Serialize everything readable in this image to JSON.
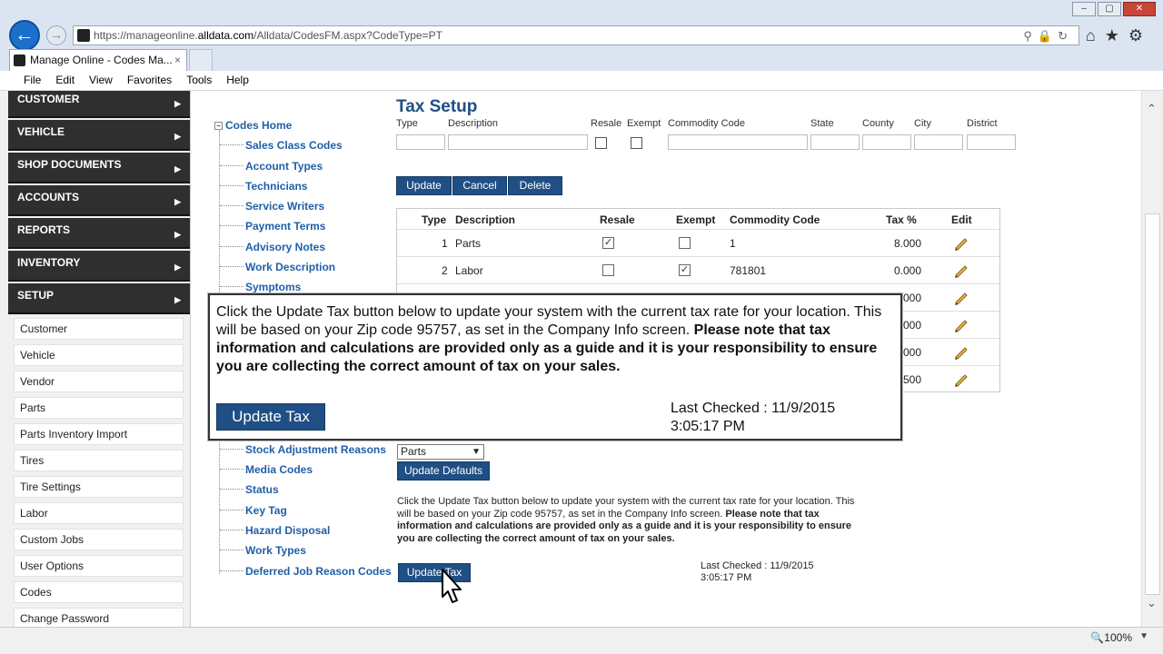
{
  "browser": {
    "url_prefix": "https://manageonline.",
    "url_domain": "alldata.com",
    "url_path": "/Alldata/CodesFM.aspx?CodeType=PT",
    "tab_title": "Manage Online - Codes Ma...",
    "tab_close": "×",
    "menu": [
      "File",
      "Edit",
      "View",
      "Favorites",
      "Tools",
      "Help"
    ],
    "zoom": "100%",
    "address_icons": "⚲🔒↻",
    "toolbar_icons": "⌂★⚙",
    "window_controls": [
      "–",
      "▢",
      "✕"
    ]
  },
  "sidebar": {
    "nav": [
      "CUSTOMER",
      "VEHICLE",
      "SHOP DOCUMENTS",
      "ACCOUNTS",
      "REPORTS",
      "INVENTORY",
      "SETUP"
    ],
    "arrow": "▶",
    "setup_items": [
      "Customer",
      "Vehicle",
      "Vendor",
      "Parts",
      "Parts Inventory Import",
      "Tires",
      "Tire Settings",
      "Labor",
      "Custom Jobs",
      "User Options",
      "Codes",
      "Change Password"
    ]
  },
  "tree": {
    "home": "Codes Home",
    "home_toggle": "−",
    "items_top": [
      "Sales Class Codes",
      "Account Types",
      "Technicians",
      "Service Writers",
      "Payment Terms",
      "Advisory Notes",
      "Work Description",
      "Symptoms"
    ],
    "items_bottom": [
      "Stock Adjustment Reasons",
      "Media Codes",
      "Status",
      "Key Tag",
      "Hazard Disposal",
      "Work Types",
      "Deferred Job Reason Codes"
    ]
  },
  "form": {
    "title": "Tax Setup",
    "labels": {
      "type": "Type",
      "description": "Description",
      "resale": "Resale",
      "exempt": "Exempt",
      "commodity": "Commodity Code",
      "state": "State",
      "county": "County",
      "city": "City",
      "district": "District"
    },
    "buttons": {
      "update": "Update",
      "cancel": "Cancel",
      "delete": "Delete"
    }
  },
  "table": {
    "headers": {
      "type": "Type",
      "description": "Description",
      "resale": "Resale",
      "exempt": "Exempt",
      "commodity": "Commodity Code",
      "tax": "Tax %",
      "edit": "Edit"
    },
    "rows": [
      {
        "type": "1",
        "description": "Parts",
        "resale": true,
        "exempt": false,
        "commodity": "1",
        "tax": "8.000"
      },
      {
        "type": "2",
        "description": "Labor",
        "resale": false,
        "exempt": true,
        "commodity": "781801",
        "tax": "0.000"
      }
    ],
    "partial_tax": [
      "000",
      "000",
      "000",
      "500"
    ],
    "check_mark": "✓"
  },
  "popup": {
    "text": "Click the Update Tax button below to update your system with the current tax rate for your location. This will be based on your Zip code 95757, as set in the Company Info screen. ",
    "bold_text": "Please note that tax information and calculations are provided only as a guide and it is your responsibility to ensure you are collecting the correct amount of tax on your sales.",
    "button": "Update Tax",
    "last_checked": "Last Checked : 11/9/2015",
    "last_checked_time": "3:05:17 PM"
  },
  "lower": {
    "select_value": "Parts",
    "select_arrow": "▼",
    "update_defaults": "Update Defaults",
    "note": "Click the Update Tax button below to update your system with the current tax rate for your location. This will be based on your Zip code 95757, as set in the Company Info screen. ",
    "note_bold": "Please note that tax information and calculations are provided only as a guide and it is your responsibility to ensure you are collecting the correct amount of tax on your sales.",
    "update_tax": "Update Tax",
    "last_checked": "Last Checked : 11/9/2015",
    "last_checked_time": "3:05:17 PM"
  },
  "scroll": {
    "up": "⌃",
    "down": "⌄"
  },
  "colors": {
    "brand_blue": "#1f4f84",
    "link_blue": "#1f5fa8",
    "nav_dark": "#2f2f2f"
  }
}
